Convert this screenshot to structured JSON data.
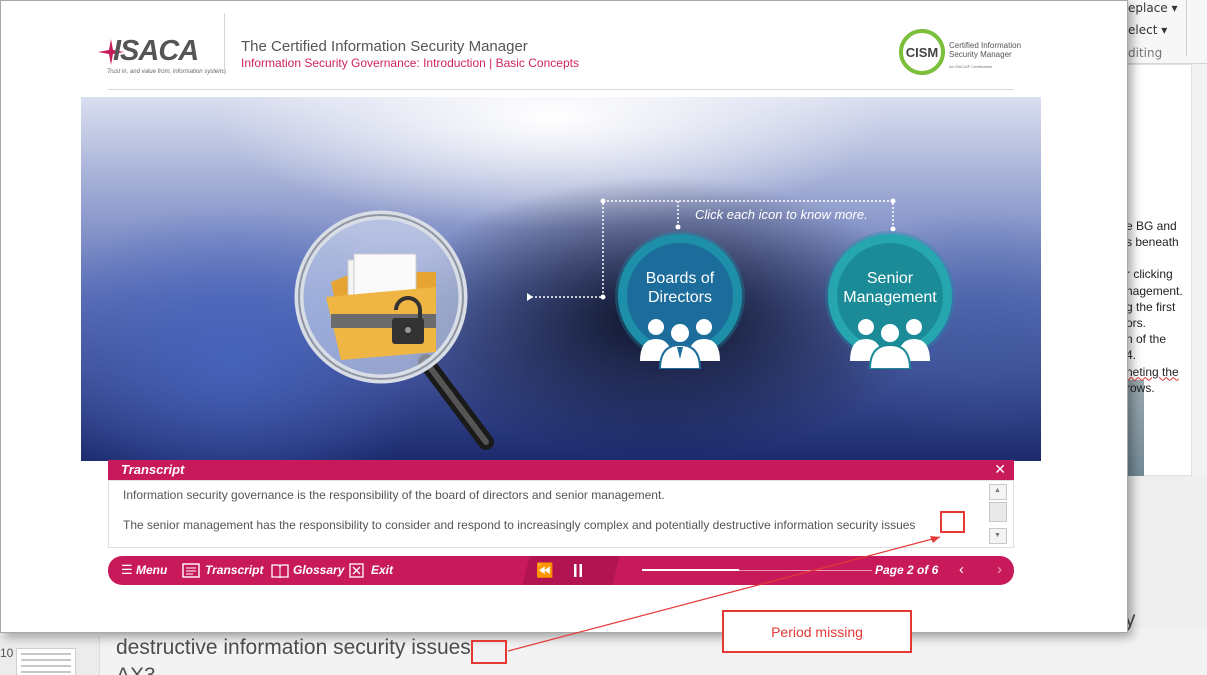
{
  "background": {
    "ribbon": {
      "replace": "eplace",
      "select": "elect",
      "editing": "diting"
    },
    "notes": [
      "e BG and",
      "s beneath",
      "",
      "r clicking",
      "nagement.",
      "g the first",
      "ors.",
      "n of the",
      "4.",
      "neting the",
      "rows."
    ],
    "slide_number": "10",
    "body_line1": "entially",
    "body_line2": "destructive information security issues",
    "body_line3": "AX3"
  },
  "header": {
    "logo": "ISACA",
    "logo_tagline": "Trust in, and value from, information systems",
    "title": "The Certified Information Security Manager",
    "subtitle": "Information Security Governance: Introduction | Basic Concepts",
    "cism_badge": "CISM",
    "cism_line1": "Certified Information",
    "cism_line2": "Security Manager",
    "cism_line3": "An ISACA® Certification"
  },
  "scene": {
    "hint": "Click each icon to know more.",
    "icons": [
      {
        "label_line1": "Boards of",
        "label_line2": "Directors",
        "icon": "group-icon"
      },
      {
        "label_line1": "Senior",
        "label_line2": "Management",
        "icon": "group-icon"
      }
    ]
  },
  "transcript": {
    "title": "Transcript",
    "close": "✕",
    "paragraphs": [
      "Information security governance is the responsibility of the board of directors and senior management.",
      "The senior management has the responsibility to consider and respond to increasingly complex and potentially destructive information security issues"
    ]
  },
  "nav": {
    "menu": "Menu",
    "transcript": "Transcript",
    "glossary": "Glossary",
    "exit": "Exit",
    "page": "Page 2 of 6",
    "progress": 0.42
  },
  "annotation": {
    "label": "Period missing",
    "color": "#e53935"
  }
}
